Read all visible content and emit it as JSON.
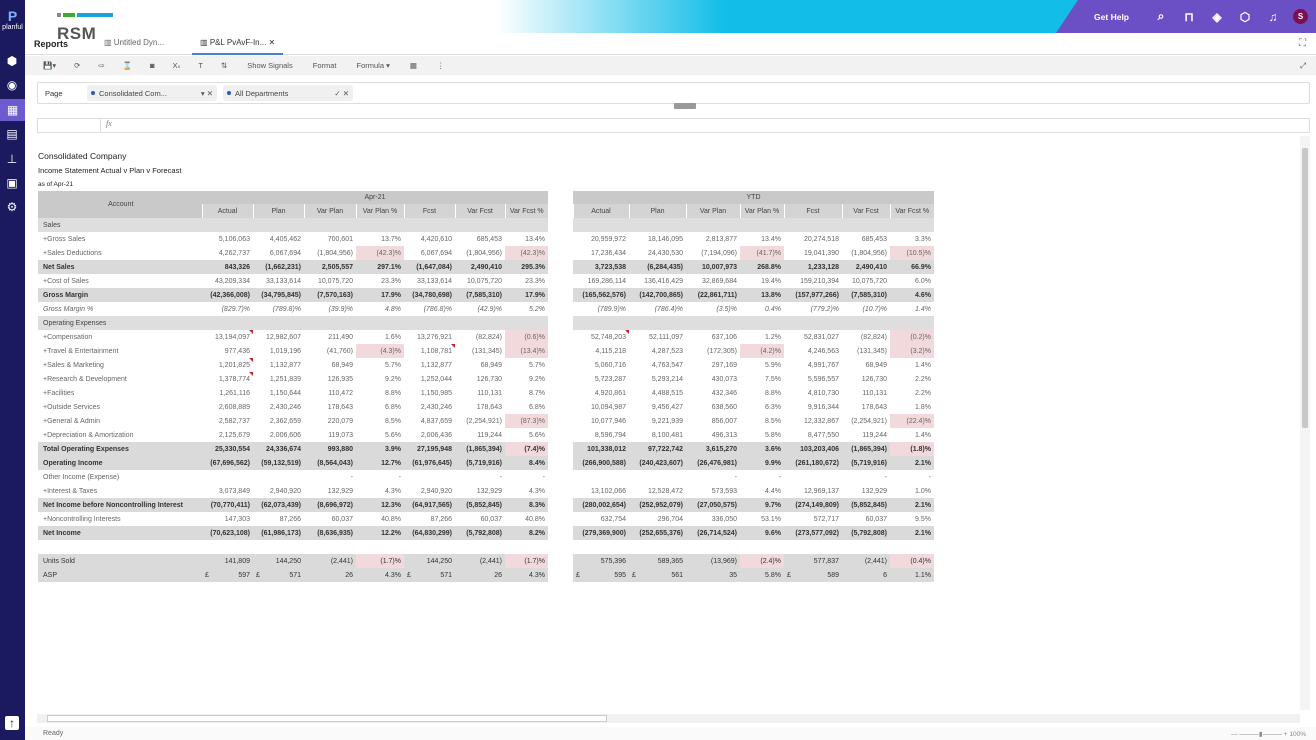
{
  "brand": {
    "name": "planful",
    "logo": "RSM",
    "logo_colors": [
      "#888888",
      "#3aaa35",
      "#1aa3d9"
    ]
  },
  "header": {
    "help": "Get Help",
    "icons": [
      "search-icon",
      "bookmark-icon",
      "target-icon",
      "cube-icon",
      "bell-icon"
    ],
    "avatar": "S",
    "accent": "#6b4fc4"
  },
  "sidebar": {
    "icons": [
      "cube-icon",
      "circle-icon",
      "grid-icon",
      "chart-icon",
      "hierarchy-icon",
      "clipboard-icon",
      "gear-icon"
    ],
    "bottom_icon": "upload-icon"
  },
  "tabs": {
    "section": "Reports",
    "items": [
      {
        "label": "Untitled Dyn..."
      },
      {
        "label": "P&L PvAvF-In...",
        "active": true
      }
    ]
  },
  "toolbar": {
    "show_signals": "Show Signals",
    "format": "Format",
    "formula": "Formula ▾"
  },
  "page": {
    "label": "Page",
    "filters": [
      {
        "value": "Consolidated Com...",
        "controls": "▾ ✕"
      },
      {
        "value": "All Departments",
        "controls": "✓ ✕"
      }
    ]
  },
  "formula_bar": {
    "fx": "fx",
    "cell": "",
    "value": ""
  },
  "report": {
    "title": "Consolidated Company",
    "subtitle": "Income Statement Actual v Plan v Forecast",
    "as_of": "as of Apr-21",
    "account_header": "Account",
    "period1": "Apr-21",
    "period2": "YTD",
    "columns": [
      "Actual",
      "Plan",
      "Var Plan",
      "Var Plan %",
      "Fcst",
      "Var Fcst",
      "Var Fcst %"
    ],
    "highlight_color": "#f2d9dc",
    "rows": [
      {
        "label": "Sales",
        "type": "section",
        "apr": [
          "",
          "",
          "",
          "",
          "",
          "",
          ""
        ],
        "ytd": [
          "",
          "",
          "",
          "",
          "",
          "",
          ""
        ]
      },
      {
        "label": "+Gross Sales",
        "type": "normal",
        "apr": [
          "5,106,063",
          "4,405,462",
          "700,601",
          "13.7%",
          "4,420,610",
          "685,453",
          "13.4%"
        ],
        "ytd": [
          "20,959,972",
          "18,146,095",
          "2,813,877",
          "13.4%",
          "20,274,518",
          "685,453",
          "3.3%"
        ]
      },
      {
        "label": "+Sales Deductions",
        "type": "normal",
        "apr": [
          "4,262,737",
          "6,067,694",
          "(1,804,956)",
          "(42.3)%",
          "6,067,694",
          "(1,804,956)",
          "(42.3)%"
        ],
        "ytd": [
          "17,236,434",
          "24,430,530",
          "(7,194,096)",
          "(41.7)%",
          "19,041,390",
          "(1,804,956)",
          "(10.5)%"
        ],
        "hl_apr": [
          3,
          6
        ],
        "hl_ytd": [
          3,
          6
        ]
      },
      {
        "label": "Net Sales",
        "type": "total",
        "apr": [
          "843,326",
          "(1,662,231)",
          "2,505,557",
          "297.1%",
          "(1,647,084)",
          "2,490,410",
          "295.3%"
        ],
        "ytd": [
          "3,723,538",
          "(6,284,435)",
          "10,007,973",
          "268.8%",
          "1,233,128",
          "2,490,410",
          "66.9%"
        ]
      },
      {
        "label": "+Cost of Sales",
        "type": "normal",
        "apr": [
          "43,209,334",
          "33,133,614",
          "10,075,720",
          "23.3%",
          "33,133,614",
          "10,075,720",
          "23.3%"
        ],
        "ytd": [
          "169,286,114",
          "136,416,429",
          "32,869,684",
          "19.4%",
          "159,210,394",
          "10,075,720",
          "6.0%"
        ]
      },
      {
        "label": "Gross Margin",
        "type": "total",
        "apr": [
          "(42,366,008)",
          "(34,795,845)",
          "(7,570,163)",
          "17.9%",
          "(34,780,698)",
          "(7,585,310)",
          "17.9%"
        ],
        "ytd": [
          "(165,562,576)",
          "(142,700,865)",
          "(22,861,711)",
          "13.8%",
          "(157,977,266)",
          "(7,585,310)",
          "4.6%"
        ]
      },
      {
        "label": "Gross Margin %",
        "type": "italic",
        "apr": [
          "(829.7)%",
          "(789.8)%",
          "(39.9)%",
          "4.8%",
          "(786.8)%",
          "(42.9)%",
          "5.2%"
        ],
        "ytd": [
          "(789.9)%",
          "(786.4)%",
          "(3.5)%",
          "0.4%",
          "(779.2)%",
          "(10.7)%",
          "1.4%"
        ]
      },
      {
        "label": "Operating Expenses",
        "type": "section",
        "apr": [
          "",
          "",
          "",
          "",
          "",
          "",
          ""
        ],
        "ytd": [
          "",
          "",
          "",
          "",
          "",
          "",
          ""
        ]
      },
      {
        "label": "+Compensation",
        "type": "normal",
        "apr": [
          "13,194,097",
          "12,982,607",
          "211,490",
          "1.6%",
          "13,276,921",
          "(82,824)",
          "(0.6)%"
        ],
        "ytd": [
          "52,748,203",
          "52,111,097",
          "637,106",
          "1.2%",
          "52,831,027",
          "(82,824)",
          "(0.2)%"
        ],
        "hl_apr": [
          6
        ],
        "hl_ytd": [
          6
        ],
        "cm_apr": [
          0
        ],
        "cm_ytd": [
          0
        ]
      },
      {
        "label": "+Travel & Entertainment",
        "type": "normal",
        "apr": [
          "977,436",
          "1,019,196",
          "(41,760)",
          "(4.3)%",
          "1,108,781",
          "(131,345)",
          "(13.4)%"
        ],
        "ytd": [
          "4,115,218",
          "4,287,523",
          "(172,305)",
          "(4.2)%",
          "4,246,563",
          "(131,345)",
          "(3.2)%"
        ],
        "hl_apr": [
          3,
          6
        ],
        "hl_ytd": [
          3,
          6
        ],
        "cm_apr": [
          4
        ]
      },
      {
        "label": "+Sales & Marketing",
        "type": "normal",
        "apr": [
          "1,201,825",
          "1,132,877",
          "68,949",
          "5.7%",
          "1,132,877",
          "68,949",
          "5.7%"
        ],
        "ytd": [
          "5,060,716",
          "4,763,547",
          "297,169",
          "5.9%",
          "4,991,767",
          "68,949",
          "1.4%"
        ],
        "cm_apr": [
          0
        ]
      },
      {
        "label": "+Research & Development",
        "type": "normal",
        "apr": [
          "1,378,774",
          "1,251,839",
          "126,935",
          "9.2%",
          "1,252,044",
          "126,730",
          "9.2%"
        ],
        "ytd": [
          "5,723,287",
          "5,293,214",
          "430,073",
          "7.5%",
          "5,596,557",
          "126,730",
          "2.2%"
        ],
        "cm_apr": [
          0
        ]
      },
      {
        "label": "+Facilities",
        "type": "normal",
        "apr": [
          "1,261,116",
          "1,150,644",
          "110,472",
          "8.8%",
          "1,150,985",
          "110,131",
          "8.7%"
        ],
        "ytd": [
          "4,920,861",
          "4,488,515",
          "432,346",
          "8.8%",
          "4,810,730",
          "110,131",
          "2.2%"
        ]
      },
      {
        "label": "+Outside Services",
        "type": "normal",
        "apr": [
          "2,608,889",
          "2,430,246",
          "178,643",
          "6.8%",
          "2,430,246",
          "178,643",
          "6.8%"
        ],
        "ytd": [
          "10,094,987",
          "9,456,427",
          "638,560",
          "6.3%",
          "9,916,344",
          "178,643",
          "1.8%"
        ]
      },
      {
        "label": "+General & Admin",
        "type": "normal",
        "apr": [
          "2,582,737",
          "2,362,659",
          "220,079",
          "8.5%",
          "4,837,659",
          "(2,254,921)",
          "(87.3)%"
        ],
        "ytd": [
          "10,077,946",
          "9,221,939",
          "856,007",
          "8.5%",
          "12,332,867",
          "(2,254,921)",
          "(22.4)%"
        ],
        "hl_apr": [
          6
        ],
        "hl_ytd": [
          6
        ]
      },
      {
        "label": "+Depreciation & Amortization",
        "type": "normal",
        "apr": [
          "2,125,679",
          "2,006,606",
          "119,073",
          "5.6%",
          "2,006,436",
          "119,244",
          "5.6%"
        ],
        "ytd": [
          "8,596,794",
          "8,100,481",
          "496,313",
          "5.8%",
          "8,477,550",
          "119,244",
          "1.4%"
        ]
      },
      {
        "label": "Total Operating Expenses",
        "type": "total",
        "apr": [
          "25,330,554",
          "24,336,674",
          "993,880",
          "3.9%",
          "27,195,948",
          "(1,865,394)",
          "(7.4)%"
        ],
        "ytd": [
          "101,338,012",
          "97,722,742",
          "3,615,270",
          "3.6%",
          "103,203,406",
          "(1,865,394)",
          "(1.8)%"
        ],
        "hl_apr": [
          6
        ],
        "hl_ytd": [
          6
        ]
      },
      {
        "label": "Operating Income",
        "type": "total",
        "apr": [
          "(67,696,562)",
          "(59,132,519)",
          "(8,564,043)",
          "12.7%",
          "(61,976,645)",
          "(5,719,916)",
          "8.4%"
        ],
        "ytd": [
          "(266,900,588)",
          "(240,423,607)",
          "(26,476,981)",
          "9.9%",
          "(261,180,672)",
          "(5,719,916)",
          "2.1%"
        ]
      },
      {
        "label": "Other Income (Expense)",
        "type": "normal",
        "apr": [
          "",
          "",
          "-",
          "-",
          "",
          "-",
          "-"
        ],
        "ytd": [
          "",
          "",
          "-",
          "-",
          "",
          "-",
          "-"
        ]
      },
      {
        "label": "+Interest & Taxes",
        "type": "normal",
        "apr": [
          "3,073,849",
          "2,940,920",
          "132,929",
          "4.3%",
          "2,940,920",
          "132,929",
          "4.3%"
        ],
        "ytd": [
          "13,102,066",
          "12,528,472",
          "573,593",
          "4.4%",
          "12,969,137",
          "132,929",
          "1.0%"
        ]
      },
      {
        "label": "Net Income before Noncontrolling Interest",
        "type": "total",
        "apr": [
          "(70,770,411)",
          "(62,073,439)",
          "(8,696,972)",
          "12.3%",
          "(64,917,565)",
          "(5,852,845)",
          "8.3%"
        ],
        "ytd": [
          "(280,002,654)",
          "(252,952,079)",
          "(27,050,575)",
          "9.7%",
          "(274,149,809)",
          "(5,852,845)",
          "2.1%"
        ]
      },
      {
        "label": "+Noncontrolling Interests",
        "type": "normal",
        "apr": [
          "147,303",
          "87,266",
          "60,037",
          "40.8%",
          "87,266",
          "60,037",
          "40.8%"
        ],
        "ytd": [
          "632,754",
          "296,704",
          "336,050",
          "53.1%",
          "572,717",
          "60,037",
          "9.5%"
        ]
      },
      {
        "label": "Net Income",
        "type": "total",
        "apr": [
          "(70,623,108)",
          "(61,986,173)",
          "(8,636,935)",
          "12.2%",
          "(64,830,299)",
          "(5,792,808)",
          "8.2%"
        ],
        "ytd": [
          "(279,369,900)",
          "(252,655,376)",
          "(26,714,524)",
          "9.6%",
          "(273,577,092)",
          "(5,792,808)",
          "2.1%"
        ]
      },
      {
        "label": "",
        "type": "blank",
        "apr": [
          "",
          "",
          "",
          "",
          "",
          "",
          ""
        ],
        "ytd": [
          "",
          "",
          "",
          "",
          "",
          "",
          ""
        ]
      },
      {
        "label": "Units Sold",
        "type": "total-light",
        "apr": [
          "141,809",
          "144,250",
          "(2,441)",
          "(1.7)%",
          "144,250",
          "(2,441)",
          "(1.7)%"
        ],
        "ytd": [
          "575,396",
          "589,365",
          "(13,969)",
          "(2.4)%",
          "577,837",
          "(2,441)",
          "(0.4)%"
        ],
        "hl_apr": [
          3,
          6
        ],
        "hl_ytd": [
          3,
          6
        ]
      },
      {
        "label": "ASP",
        "type": "total-light",
        "currency": "£",
        "currency_cols": [
          0,
          1,
          4
        ],
        "apr": [
          "597",
          "571",
          "26",
          "4.3%",
          "571",
          "26",
          "4.3%"
        ],
        "ytd": [
          "595",
          "561",
          "35",
          "5.8%",
          "589",
          "6",
          "1.1%"
        ]
      }
    ]
  },
  "status": {
    "text": "Ready",
    "zoom": "100%"
  }
}
